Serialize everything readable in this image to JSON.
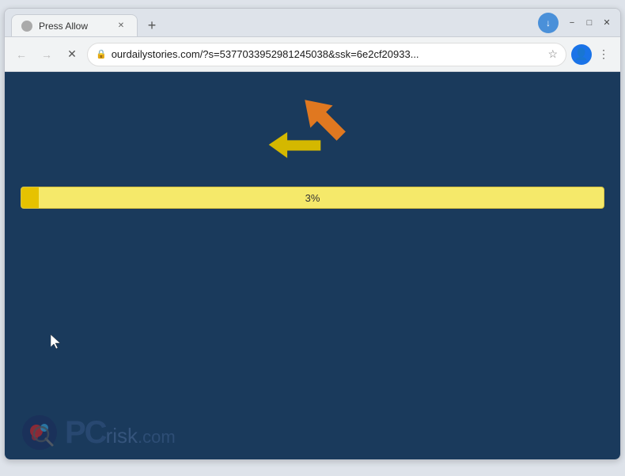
{
  "browser": {
    "tab": {
      "title": "Press Allow",
      "favicon": "page-icon"
    },
    "new_tab_label": "+",
    "window_controls": {
      "minimize": "−",
      "maximize": "□",
      "close": "✕"
    },
    "nav": {
      "back": "←",
      "forward": "→",
      "reload": "✕"
    },
    "address_bar": {
      "url": "ourdailystories.com/?s=5377033952981245038&ssk=6e2cf20933...",
      "lock_icon": "🔒"
    },
    "toolbar": {
      "star": "☆",
      "download_indicator": "↓",
      "profile_icon": "👤",
      "more_options": "⋮"
    }
  },
  "page": {
    "background_color": "#1a3a5c",
    "progress": {
      "value": 3,
      "label": "3%",
      "fill_color": "#e6c200",
      "bg_color": "#f5e96a"
    },
    "arrow_orange_color": "#e07820",
    "arrow_yellow_color": "#d4b800"
  },
  "watermark": {
    "text_pc": "PC",
    "text_risk": "risk",
    "text_dot": ".",
    "text_com": "com"
  }
}
